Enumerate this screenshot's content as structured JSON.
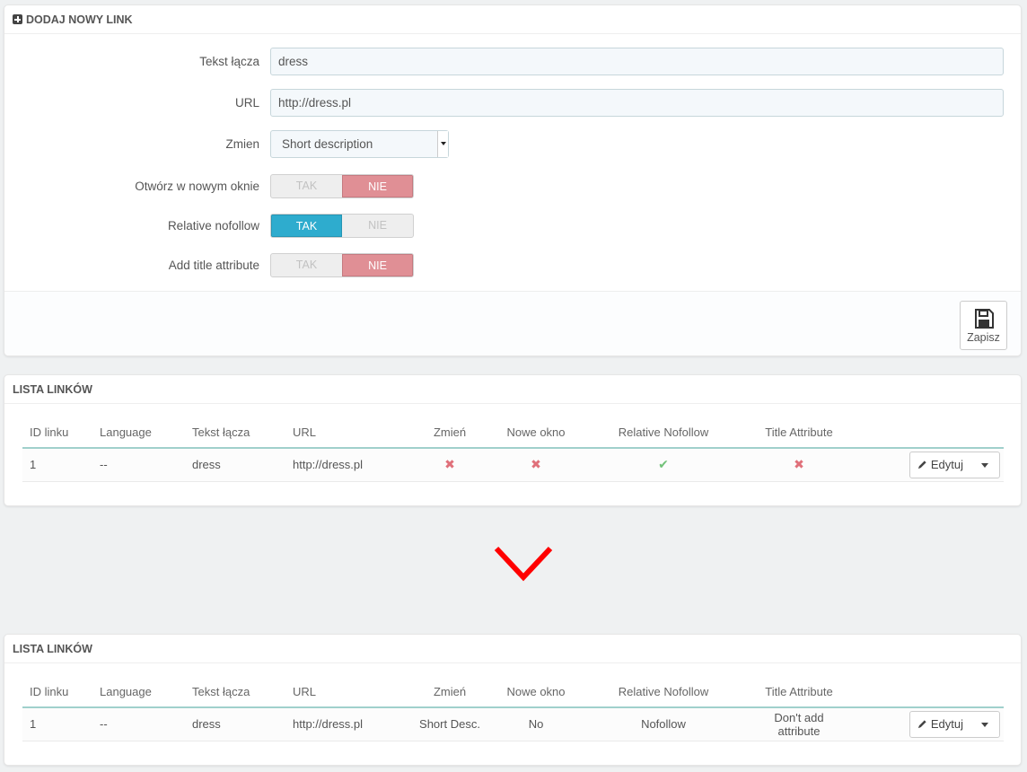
{
  "form_panel": {
    "heading": "DODAJ NOWY LINK",
    "fields": {
      "link_text": {
        "label": "Tekst łącza",
        "value": "dress"
      },
      "url": {
        "label": "URL",
        "value": "http://dress.pl"
      },
      "change": {
        "label": "Zmien",
        "selected": "Short description"
      },
      "new_window": {
        "label": "Otwórz w nowym oknie",
        "yes": "TAK",
        "no": "NIE",
        "active": "no"
      },
      "nofollow": {
        "label": "Relative nofollow",
        "yes": "TAK",
        "no": "NIE",
        "active": "yes"
      },
      "title_attr": {
        "label": "Add title attribute",
        "yes": "TAK",
        "no": "NIE",
        "active": "no"
      }
    },
    "save_label": "Zapisz"
  },
  "list_panel_1": {
    "heading": "LISTA LINKÓW",
    "columns": [
      "ID linku",
      "Language",
      "Tekst łącza",
      "URL",
      "Zmień",
      "Nowe okno",
      "Relative Nofollow",
      "Title Attribute"
    ],
    "row": {
      "id": "1",
      "language": "--",
      "text": "dress",
      "url": "http://dress.pl",
      "change": "✖",
      "new_window": "✖",
      "nofollow": "✔",
      "title": "✖"
    },
    "edit_label": "Edytuj"
  },
  "list_panel_2": {
    "heading": "LISTA LINKÓW",
    "columns": [
      "ID linku",
      "Language",
      "Tekst łącza",
      "URL",
      "Zmień",
      "Nowe okno",
      "Relative Nofollow",
      "Title Attribute"
    ],
    "row": {
      "id": "1",
      "language": "--",
      "text": "dress",
      "url": "http://dress.pl",
      "change": "Short Desc.",
      "new_window": "No",
      "nofollow": "Nofollow",
      "title": "Don't add attribute"
    },
    "edit_label": "Edytuj"
  },
  "colors": {
    "accent_yes": "#2eacce",
    "accent_no": "#e08f95",
    "arrow": "#ff0000",
    "check": "#72c279",
    "cross": "#e0707a"
  }
}
